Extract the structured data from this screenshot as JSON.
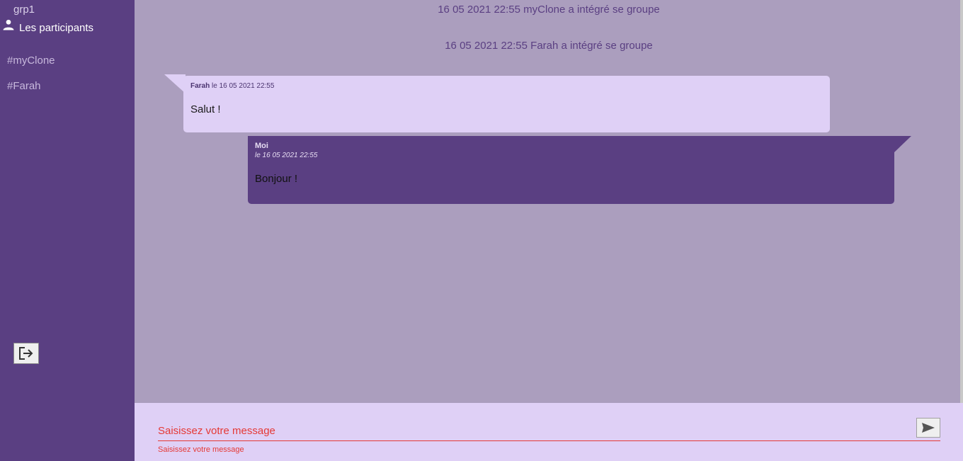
{
  "sidebar": {
    "group_name": "grp1",
    "participants_label": "Les participants",
    "participants": [
      "#myClone",
      "#Farah"
    ]
  },
  "chat": {
    "system_messages": [
      "16 05 2021 22:55 myClone a intégré se groupe",
      "16 05 2021 22:55 Farah a intégré se groupe"
    ],
    "incoming": {
      "author": "Farah",
      "date": "le 16 05 2021 22:55",
      "text": "Salut !"
    },
    "outgoing": {
      "author": "Moi",
      "date": "le 16 05 2021 22:55",
      "text": "Bonjour !"
    }
  },
  "composer": {
    "placeholder": "Saisissez votre message",
    "hint": "Saisissez votre message"
  },
  "colors": {
    "sidebar_bg": "#5a3f82",
    "chat_bg": "#ab9ebe",
    "incoming_bubble": "#dfd0f6",
    "outgoing_bubble": "#5a3f82",
    "error": "#e53935"
  },
  "icons": {
    "participants": "person-icon",
    "logout": "logout-icon",
    "send": "send-icon"
  }
}
